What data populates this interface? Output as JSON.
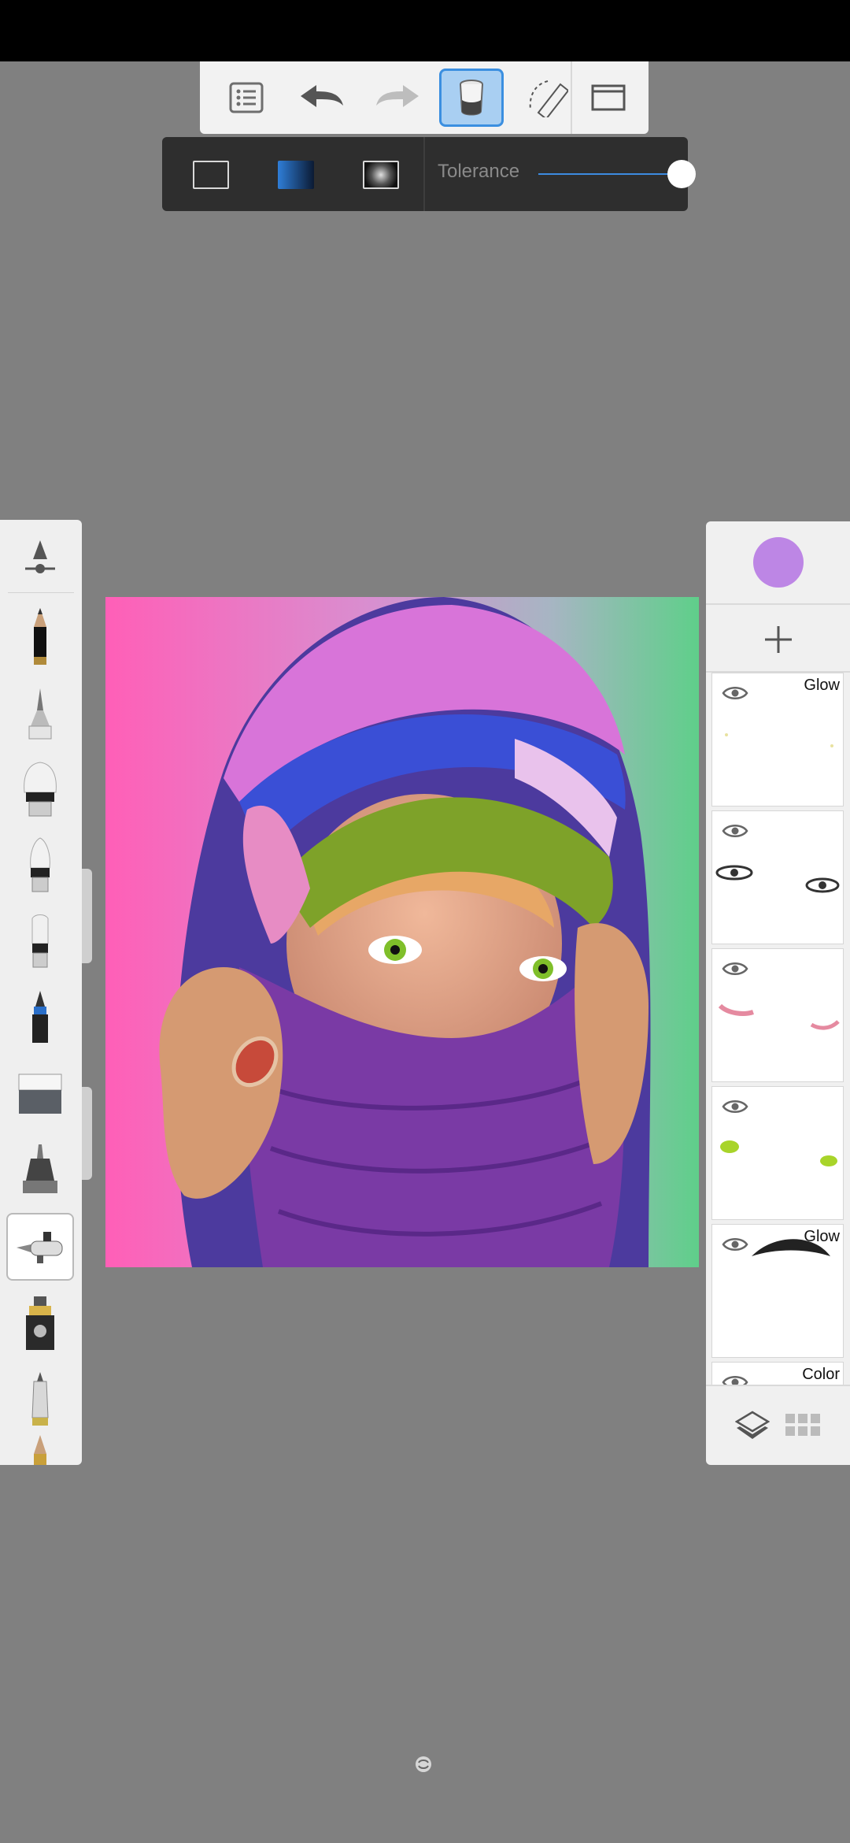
{
  "toolbar": {
    "items": [
      {
        "name": "menu-list-icon"
      },
      {
        "name": "undo-icon"
      },
      {
        "name": "redo-icon"
      },
      {
        "name": "fill-bucket-icon",
        "active": true
      },
      {
        "name": "ruler-icon"
      },
      {
        "name": "fullscreen-icon"
      }
    ]
  },
  "fill_panel": {
    "modes": [
      "solid-fill",
      "linear-gradient-fill",
      "radial-gradient-fill"
    ],
    "tolerance_label": "Tolerance",
    "tolerance_value": 1.0
  },
  "brushes": {
    "items": [
      "brush-settings",
      "pencil",
      "ballpoint-pen",
      "paintbrush-wide",
      "paintbrush-round",
      "paintbrush-flat",
      "marker",
      "eraser",
      "ink-pen",
      "airbrush",
      "chisel-marker",
      "felt-pen",
      "pencil-partial"
    ],
    "selected": "airbrush"
  },
  "colors": {
    "current_color": "#bd86e5",
    "accent": "#3b8fe0"
  },
  "layers": [
    {
      "blend": "Glow",
      "content": "sparkles"
    },
    {
      "blend": "",
      "content": "eyes-outline"
    },
    {
      "blend": "",
      "content": "pink-lids"
    },
    {
      "blend": "",
      "content": "green-irises"
    },
    {
      "blend": "Glow",
      "content": "eyebrows"
    },
    {
      "blend": "Color",
      "content": "partial"
    }
  ]
}
